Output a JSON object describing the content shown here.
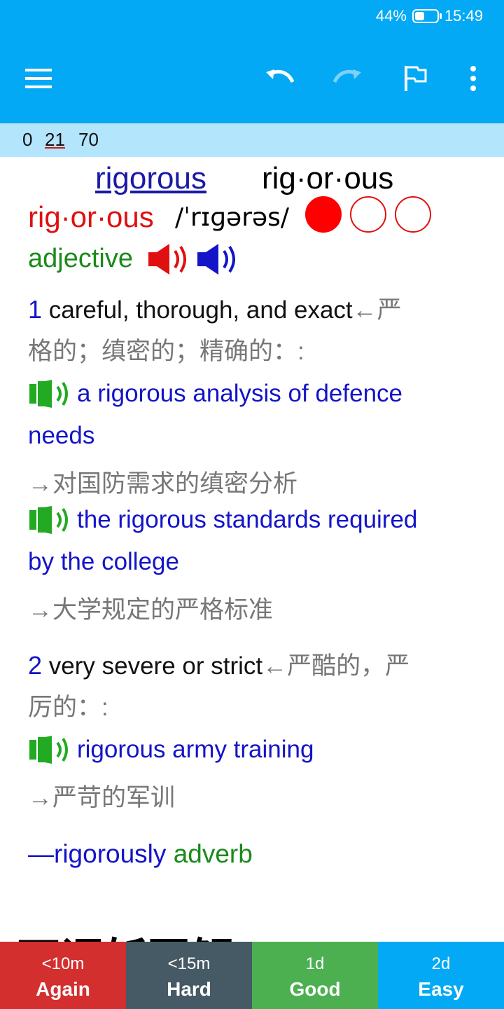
{
  "status": {
    "battery": "44%",
    "time": "15:49",
    "battery_level": 0.44
  },
  "toolbar": {
    "menu_icon": "hamburger-menu-icon",
    "undo_icon": "undo-icon",
    "redo_icon": "redo-icon",
    "flag_icon": "flag-icon",
    "more_icon": "more-vert-icon"
  },
  "counts": {
    "new": "0",
    "learning": "21",
    "review": "70"
  },
  "card": {
    "title_link": "rigorous ",
    "title_syllables": "rig·or·ous",
    "headword": "rig·or·ous",
    "pronunciation": "/ˈrɪɡərəs/",
    "part_of_speech": "adjective",
    "senses": [
      {
        "number": "1",
        "definition": "careful, thorough, and exact",
        "definition_zh_line1": "←严",
        "definition_zh_line2": "格的；缜密的；精确的：:",
        "examples": [
          {
            "line1": "a rigorous analysis of defence",
            "line2": "needs",
            "translation": "→对国防需求的缜密分析"
          },
          {
            "line1": "the rigorous standards required",
            "line2": "by the college",
            "translation": "→大学规定的严格标准"
          }
        ]
      },
      {
        "number": "2",
        "definition": "very severe or strict",
        "definition_zh_line1": "←严酷的，严",
        "definition_zh_line2": "厉的：:",
        "examples": [
          {
            "line1": "rigorous army training",
            "translation": "→严苛的军训"
          }
        ]
      }
    ],
    "derivative": {
      "word": "—rigorously",
      "pos": "adverb"
    },
    "next_section_heading": "万词斩同解"
  },
  "answer_buttons": [
    {
      "interval": "<10m",
      "label": "Again",
      "color": "#d32f2f"
    },
    {
      "interval": "<15m",
      "label": "Hard",
      "color": "#455a64"
    },
    {
      "interval": "1d",
      "label": "Good",
      "color": "#4caf50"
    },
    {
      "interval": "2d",
      "label": "Easy",
      "color": "#03a9f4"
    }
  ]
}
